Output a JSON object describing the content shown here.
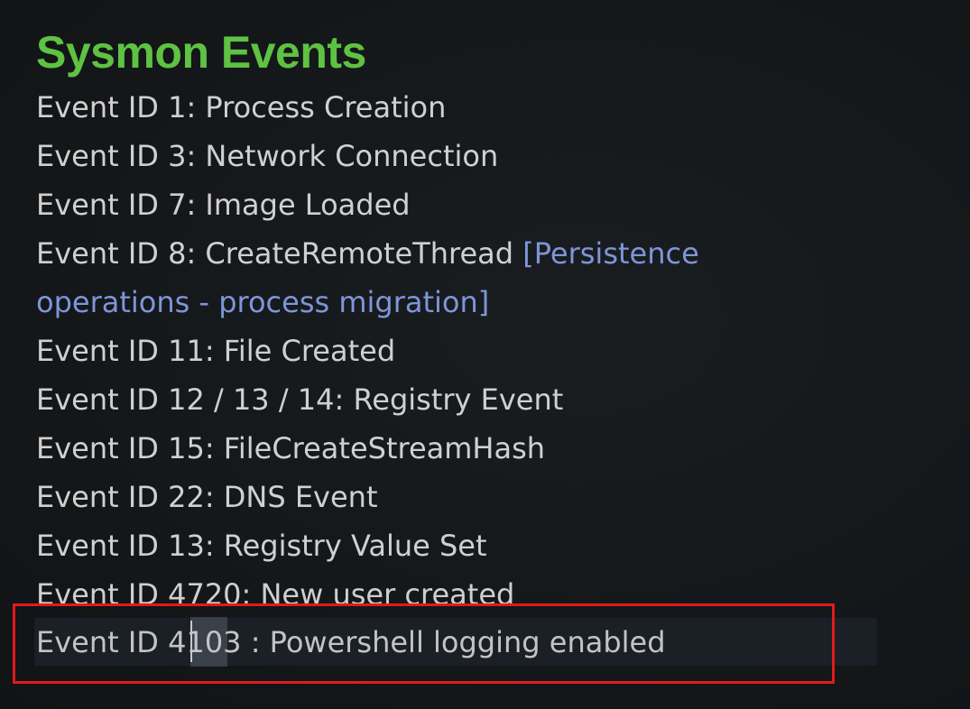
{
  "title": "Sysmon Events",
  "events": [
    {
      "text": "Event ID 1: Process Creation"
    },
    {
      "text": "Event ID 3: Network Connection"
    },
    {
      "text": "Event ID 7: Image Loaded"
    },
    {
      "text": "Event ID 8: CreateRemoteThread ",
      "note": "[Persistence"
    },
    {
      "text": "",
      "note": "operations - process migration]"
    },
    {
      "text": "Event ID 11: File Created"
    },
    {
      "text": "Event ID 12 / 13 / 14: Registry Event"
    },
    {
      "text": "Event ID 15: FileCreateStreamHash"
    },
    {
      "text": "Event ID 22: DNS Event"
    },
    {
      "text": "Event ID 13: Registry Value Set"
    }
  ],
  "partial_line": "Event ID 4720: New user created",
  "current_line": "Event ID 4103 : Powershell logging enabled",
  "colors": {
    "title": "#5ec242",
    "note": "#7e95d9",
    "highlight_border": "#e01b1b"
  }
}
